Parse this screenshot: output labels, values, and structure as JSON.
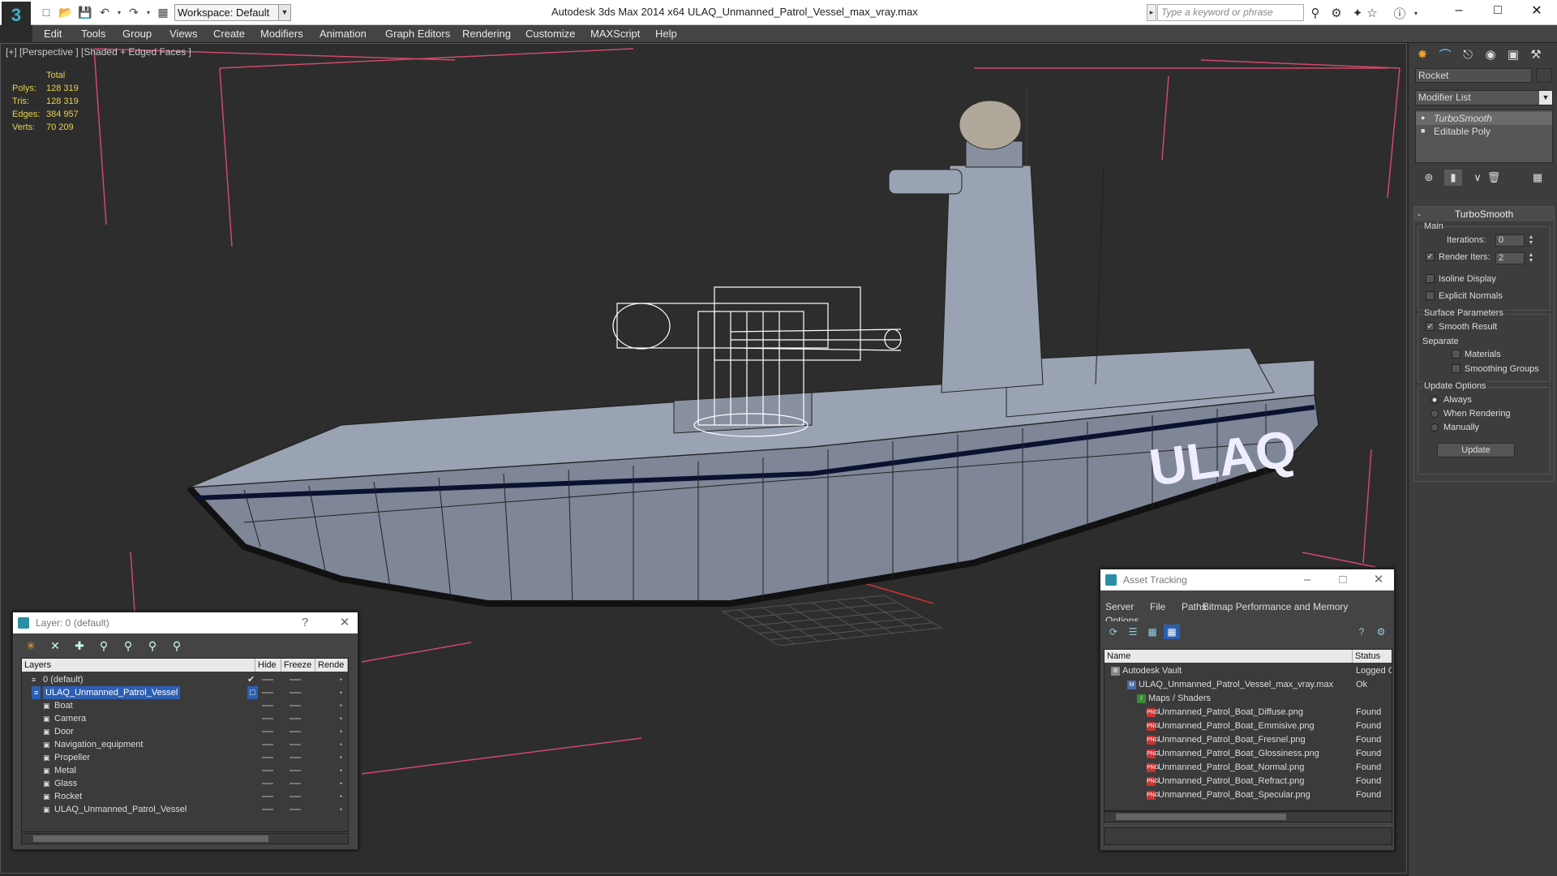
{
  "titlebar": {
    "workspace": "Workspace: Default",
    "app_title": "Autodesk 3ds Max  2014 x64",
    "file_title": "ULAQ_Unmanned_Patrol_Vessel_max_vray.max",
    "search_placeholder": "Type a keyword or phrase"
  },
  "menu": [
    "Edit",
    "Tools",
    "Group",
    "Views",
    "Create",
    "Modifiers",
    "Animation",
    "Graph Editors",
    "Rendering",
    "Customize",
    "MAXScript",
    "Help"
  ],
  "viewport": {
    "label": "[+] [Perspective ] [Shaded + Edged Faces ]",
    "stats": {
      "header": "Total",
      "rows": [
        {
          "k": "Polys:",
          "v": "128 319"
        },
        {
          "k": "Tris:",
          "v": "128 319"
        },
        {
          "k": "Edges:",
          "v": "384 957"
        },
        {
          "k": "Verts:",
          "v": "70 209"
        }
      ]
    },
    "hull_text": "ULAQ"
  },
  "command_panel": {
    "object_name": "Rocket",
    "modifier_list": "Modifier List",
    "stack": [
      "TurboSmooth",
      "Editable Poly"
    ],
    "rollout_title": "TurboSmooth",
    "main_label": "Main",
    "iterations_label": "Iterations:",
    "iterations_value": "0",
    "render_iters_label": "Render Iters:",
    "render_iters_value": "2",
    "isoline": "Isoline Display",
    "explicit_normals": "Explicit Normals",
    "surface_params": "Surface Parameters",
    "smooth_result": "Smooth Result",
    "separate": "Separate",
    "materials": "Materials",
    "smoothing_groups": "Smoothing Groups",
    "update_options": "Update Options",
    "always": "Always",
    "when_rendering": "When Rendering",
    "manually": "Manually",
    "update_btn": "Update"
  },
  "layer_window": {
    "title": "Layer: 0 (default)",
    "help": "?",
    "columns": [
      "Layers",
      "Hide",
      "Freeze",
      "Rende"
    ],
    "rows": [
      {
        "name": "0 (default)",
        "level": 1
      },
      {
        "name": "ULAQ_Unmanned_Patrol_Vessel",
        "level": 1
      },
      {
        "name": "Boat",
        "level": 2
      },
      {
        "name": "Camera",
        "level": 2
      },
      {
        "name": "Door",
        "level": 2
      },
      {
        "name": "Navigation_equipment",
        "level": 2
      },
      {
        "name": "Propeller",
        "level": 2
      },
      {
        "name": "Metal",
        "level": 2
      },
      {
        "name": "Glass",
        "level": 2
      },
      {
        "name": "Rocket",
        "level": 2
      },
      {
        "name": "ULAQ_Unmanned_Patrol_Vessel",
        "level": 2
      }
    ]
  },
  "asset_window": {
    "title": "Asset Tracking",
    "menu": [
      "Server",
      "File",
      "Paths",
      "Bitmap Performance and Memory",
      "Options"
    ],
    "columns": [
      "Name",
      "Status"
    ],
    "rows": [
      {
        "name": "Autodesk Vault",
        "status": "Logged Out",
        "level": 1
      },
      {
        "name": "ULAQ_Unmanned_Patrol_Vessel_max_vray.max",
        "status": "Ok",
        "level": 2
      },
      {
        "name": "Maps / Shaders",
        "status": "",
        "level": 3
      },
      {
        "name": "Unmanned_Patrol_Boat_Diffuse.png",
        "status": "Found",
        "level": 4
      },
      {
        "name": "Unmanned_Patrol_Boat_Emmisive.png",
        "status": "Found",
        "level": 4
      },
      {
        "name": "Unmanned_Patrol_Boat_Fresnel.png",
        "status": "Found",
        "level": 4
      },
      {
        "name": "Unmanned_Patrol_Boat_Glossiness.png",
        "status": "Found",
        "level": 4
      },
      {
        "name": "Unmanned_Patrol_Boat_Normal.png",
        "status": "Found",
        "level": 4
      },
      {
        "name": "Unmanned_Patrol_Boat_Refract.png",
        "status": "Found",
        "level": 4
      },
      {
        "name": "Unmanned_Patrol_Boat_Specular.png",
        "status": "Found",
        "level": 4
      }
    ]
  }
}
